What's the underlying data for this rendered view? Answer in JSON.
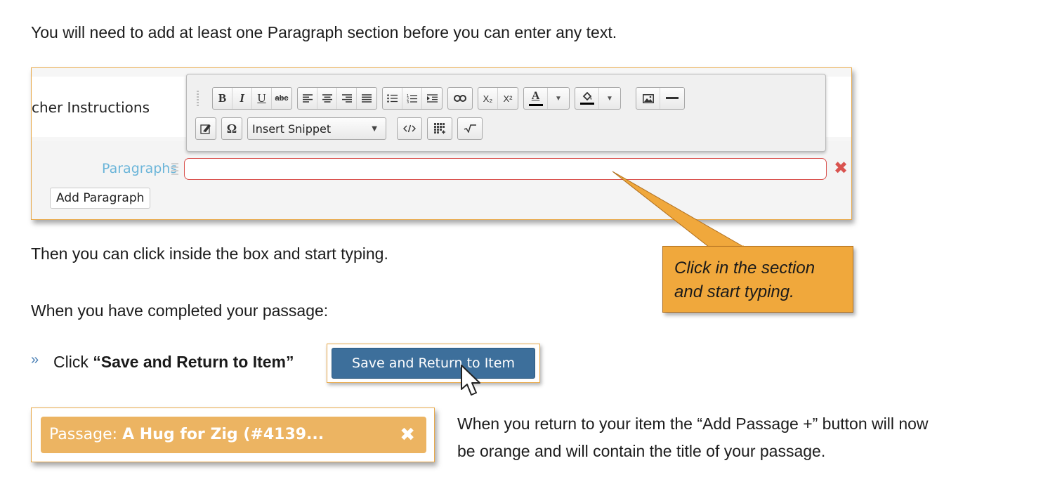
{
  "intro_text": "You will need to add at least one Paragraph section before you can enter any text.",
  "editor": {
    "teacher_label": "cher Instructions",
    "paragraphs_label": "Paragraphs",
    "add_paragraph": "Add Paragraph",
    "remove_icon": "✖",
    "toolbar": {
      "bold": "B",
      "italic": "I",
      "underline": "U",
      "strike": "abc",
      "subscript": "X₂",
      "superscript": "X²",
      "text_color": "A",
      "snippet_select": "Insert Snippet",
      "special_char": "Ω",
      "dropdown_arrow": "▼"
    }
  },
  "callout": {
    "line1": "Click in the section",
    "line2": "and start typing."
  },
  "then_text": "Then you can click inside the box and start typing.",
  "completed_text": "When you have completed your passage:",
  "step": {
    "bullet": "»",
    "prefix": "Click ",
    "bold": "“Save and Return to Item”",
    "button_label": "Save and Return to Item"
  },
  "passage": {
    "prefix": "Passage: ",
    "title": "A Hug for Zig (#4139...",
    "close": "✖"
  },
  "return_text": {
    "line1": "When you return to your item the “Add Passage +” button will now",
    "line2": "be orange and will contain the title of your passage."
  },
  "colors": {
    "frame_border": "#e8a94a",
    "callout_bg": "#f0a83c",
    "save_button": "#3d6f9b",
    "passage_button": "#ecb462",
    "error_red": "#d9534f",
    "label_blue": "#6bb5d9"
  }
}
